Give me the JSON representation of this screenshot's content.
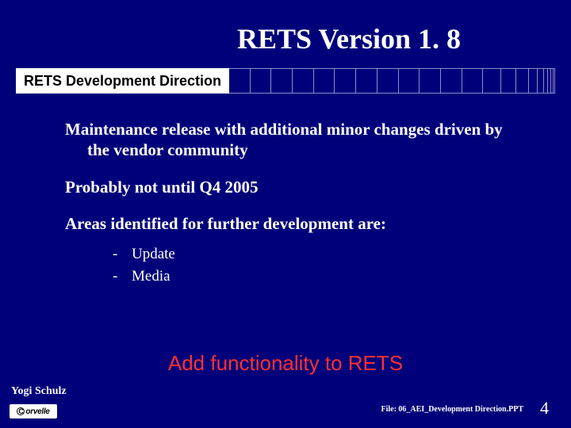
{
  "title": "RETS Version 1. 8",
  "subtitle": "RETS Development Direction",
  "body": {
    "p1": "Maintenance release with additional minor changes driven by the vendor community",
    "p2": "Probably not until Q4 2005",
    "p3": "Areas identified for further development are:",
    "sublist": [
      {
        "dash": "-",
        "text": "Update"
      },
      {
        "dash": "-",
        "text": "Media"
      }
    ]
  },
  "callout": "Add functionality to RETS",
  "author": "Yogi Schulz",
  "logo": {
    "symbol": "C",
    "text": "orvelle"
  },
  "filepath": "File: 06_AEI_Development Direction.PPT",
  "page_number": "4"
}
